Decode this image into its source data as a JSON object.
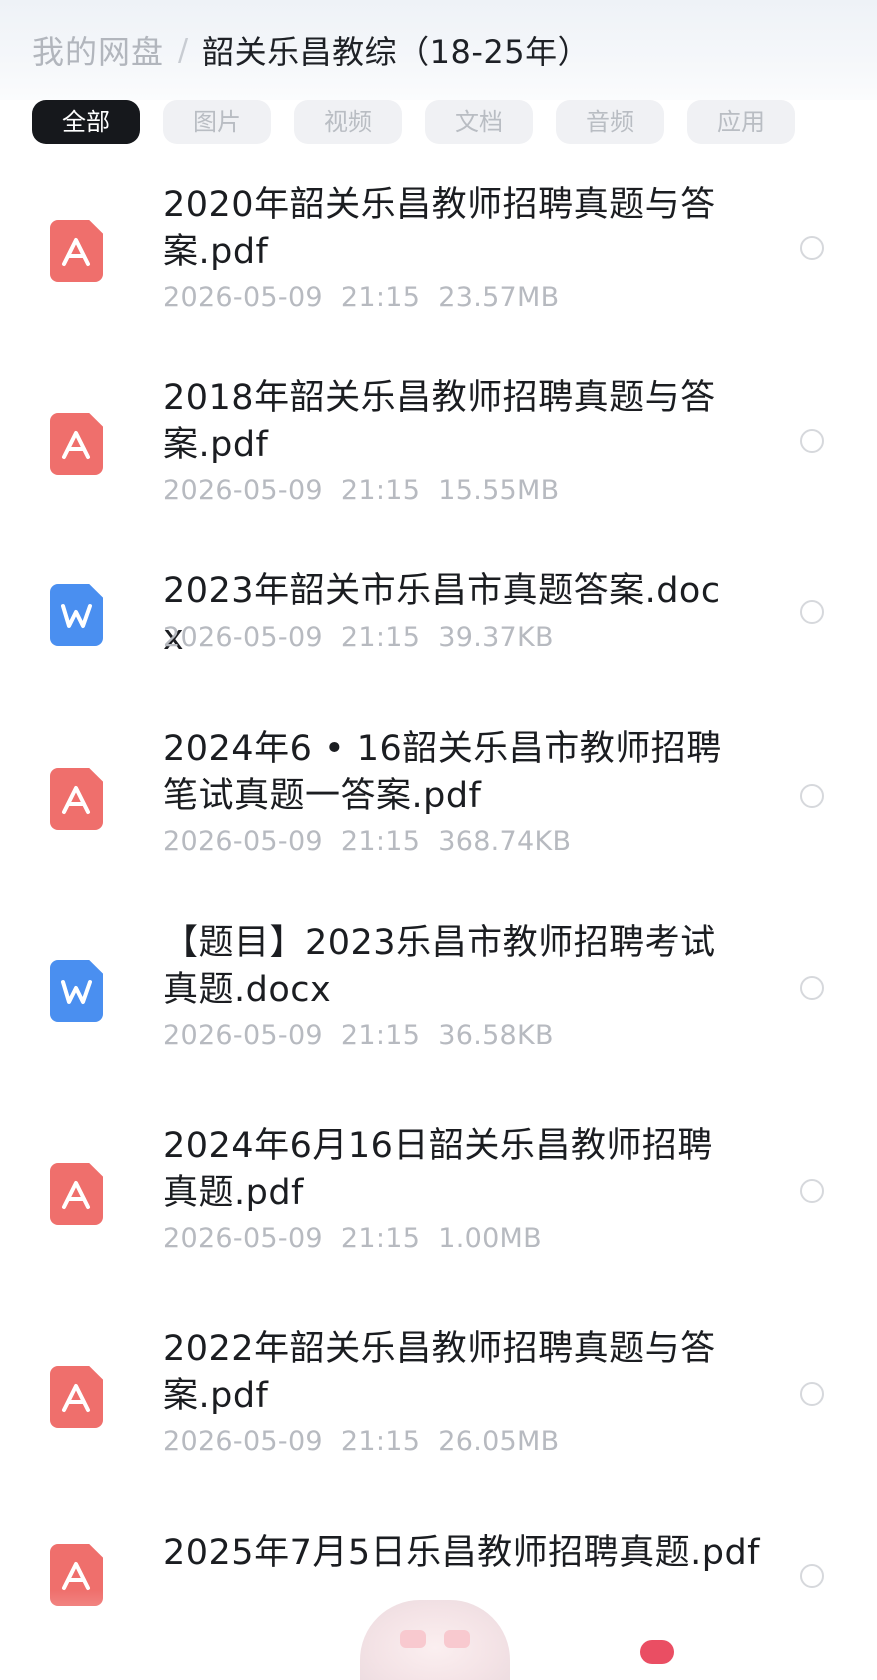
{
  "breadcrumb": {
    "root": "我的网盘",
    "separator": "/",
    "current": "韶关乐昌教综（18-25年）"
  },
  "filters": [
    {
      "label": "全部",
      "active": true
    },
    {
      "label": "图片",
      "active": false
    },
    {
      "label": "视频",
      "active": false
    },
    {
      "label": "文档",
      "active": false
    },
    {
      "label": "音频",
      "active": false
    },
    {
      "label": "应用",
      "active": false
    }
  ],
  "files": [
    {
      "type": "pdf",
      "icon": "pdf-file-icon",
      "name": "2020年韶关乐昌教师招聘真题与答案.pdf",
      "date": "2026-05-09",
      "time": "21:15",
      "size": "23.57MB"
    },
    {
      "type": "pdf",
      "icon": "pdf-file-icon",
      "name": "2018年韶关乐昌教师招聘真题与答案.pdf",
      "date": "2026-05-09",
      "time": "21:15",
      "size": "15.55MB"
    },
    {
      "type": "doc",
      "icon": "word-file-icon",
      "name": "2023年韶关市乐昌市真题答案.docx",
      "date": "2026-05-09",
      "time": "21:15",
      "size": "39.37KB"
    },
    {
      "type": "pdf",
      "icon": "pdf-file-icon",
      "name": "2024年6 • 16韶关乐昌市教师招聘笔试真题一答案.pdf",
      "date": "2026-05-09",
      "time": "21:15",
      "size": "368.74KB"
    },
    {
      "type": "doc",
      "icon": "word-file-icon",
      "name": "【题目】2023乐昌市教师招聘考试真题.docx",
      "date": "2026-05-09",
      "time": "21:15",
      "size": "36.58KB"
    },
    {
      "type": "pdf",
      "icon": "pdf-file-icon",
      "name": "2024年6月16日韶关乐昌教师招聘真题.pdf",
      "date": "2026-05-09",
      "time": "21:15",
      "size": "1.00MB"
    },
    {
      "type": "pdf",
      "icon": "pdf-file-icon",
      "name": "2022年韶关乐昌教师招聘真题与答案.pdf",
      "date": "2026-05-09",
      "time": "21:15",
      "size": "26.05MB"
    },
    {
      "type": "pdf",
      "icon": "pdf-file-icon",
      "name": "2025年7月5日乐昌教师招聘真题.pdf",
      "date": "",
      "time": "",
      "size": ""
    }
  ],
  "colors": {
    "pdf": "#ef6f6c",
    "doc": "#4a8ff0",
    "active_chip": "#16181c"
  }
}
